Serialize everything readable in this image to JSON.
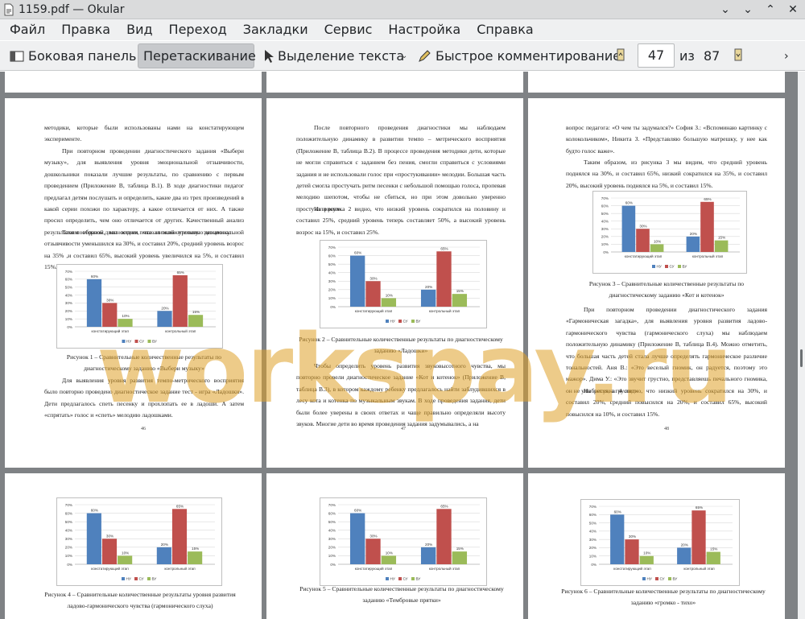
{
  "window": {
    "title": "1159.pdf — Okular"
  },
  "menu": [
    "Файл",
    "Правка",
    "Вид",
    "Переход",
    "Закладки",
    "Сервис",
    "Настройка",
    "Справка"
  ],
  "toolbar": {
    "sidebar_label": "Боковая панель",
    "drag_label": "Перетаскивание",
    "select_label": "Выделение текста",
    "comment_label": "Быстрое комментирование",
    "page_current": "47",
    "page_of": "из",
    "page_total": "87"
  },
  "pages": {
    "p46": {
      "paras": [
        {
          "text": "методики, которые были использованы нами на констатирующем эксперименте.",
          "indent": false
        },
        {
          "text": "При повторном проведении диагностического задания «Выбери музыку», для выявления уровня эмоциональной отзывчивости, дошкольники показали лучшие результаты, по сравнению с первым проведением (Приложение В, таблица В.1). В ходе диагностики педагог предлагал детям послушать и определить, какие два из трех произведений в какой серии похожи по характеру, а какое отличается от них. А также просил определить, чем оно отличается от других. Качественный анализ результатов повторной диагностики показал положительную динамику.",
          "indent": true
        },
        {
          "text": "Таким образом, мы видим, что низкий уровень эмоциональной отзывчивости уменьшился на 30%, и составил 20%, средний уровень возрос на 35% ,и составил 65%, высокий уровень увеличился на 5%, и составил 15%.",
          "indent": true
        }
      ],
      "caption": "Рисунок 1 – Сравнительные количественные результаты по диагностическому заданию «Выбери музыку»",
      "after": "Для выявления уровня развития темпо-метрического восприятия было повторно проведено диагностическое задание тест - игра «Ладошки». Дети предлагалось спеть песенку и прохлопать ее в ладоши. А затем «спрятать» голос и «спеть» мелодию ладошками.",
      "number": "46"
    },
    "p47": {
      "paras": [
        {
          "text": "После повторного проведения диагностики мы наблюдаем положительную динамику в развитии темпо – метрического восприятия (Приложение В, таблица В.2). В процессе проведения методики дети, которые не могли справиться с заданием без пения, смогли справиться с условиями задания и не использовали голос при «простукивании» мелодии. Большая часть детей смогла простучать ритм песенки с небольшой помощью голоса, пропевая мелодию шепотом, чтобы не сбиться, но при этом довольно уверенно простучали ритм.",
          "indent": true
        },
        {
          "text": "Из рисунка 2 видно, что низкий уровень сократился на половину и составил 25%, средний уровень теперь составляет 50%, а высокий уровень возрос на 15%, и составил 25%.",
          "indent": true
        }
      ],
      "caption": "Рисунок 2 – Сравнительные количественные результаты по диагностическому заданию «Ладошки»",
      "after": "Чтобы определить уровень развития звуковысотного чувства, мы повторно провели диагностическое задание «Кот и котенок» (Приложение В, таблица В.3), в котором каждому ребенку предлагалось найти заблудившихся в лесу кота и котенка по музыкальным звукам. В ходе проведения задания, дети были более уверены в своих ответах и чаще правильно определяли высоту звуков. Многие дети во время проведения задания задумывались, а на",
      "number": "47"
    },
    "p48": {
      "paras": [
        {
          "text": "вопрос педагога: «О чем ты задумался?» София З.: «Вспоминаю картинку с колокольчиком», Никита З. «Представляю большую матрешку, у нее как будто голос важе».",
          "indent": false
        },
        {
          "text": "Таким образом, из рисунка 3 мы видим, что средний уровень поднялся на 30%, и составил 65%, низкий сократился на 35%, и составил 20%, высокий уровень поднялся на 5%, и составил 15%.",
          "indent": true
        }
      ],
      "caption": "Рисунок 3 – Сравнительные количественные результаты по диагностическому заданию «Кот и котенок»",
      "after": "При повторном проведении диагностического задания «Гармоническая загадка», для выявления уровня развития ладово-гармонического чувства (гармонического слуха) мы наблюдаем положительную динамику (Приложение В, таблица В.4). Можно отметить, что большая часть детей стала лучше определять гармоническое различие тональностей. Аня В.: «Это веселый гномик, он радуется, поэтому это мажор». Дима У.: «Это звучит грустно, представляешь печального гномика, он не улыбается, а грустит»",
      "after2": "Из рисунка 4 видно, что низкий уровень сократился на 30%, и составил 20%, средний повысился на 20%, и составил 65%, высокий повысился на 10%, и составил 15%.",
      "number": "48"
    },
    "p49": {
      "caption": "Рисунок 4 – Сравнительные количественные результаты уровня развития ладово-гармонического чувства (гармонического слуха)"
    },
    "p50": {
      "caption": "Рисунок 5 – Сравнительные количественные результаты по диагностическому заданию «Тембровые прятки»"
    },
    "p51": {
      "caption": "Рисунок 6 – Сравнительные количественные результаты по диагностическому заданию «громко - тихо»"
    }
  },
  "watermark": "workspay.ru",
  "chart_data": [
    {
      "id": "fig1",
      "type": "bar",
      "categories": [
        "констатирующий этап",
        "контрольный этап"
      ],
      "series": [
        {
          "name": "НУ",
          "color": "#4f81bd",
          "values": [
            60,
            20
          ]
        },
        {
          "name": "СУ",
          "color": "#c0504d",
          "values": [
            30,
            65
          ]
        },
        {
          "name": "ВУ",
          "color": "#9bbb59",
          "values": [
            10,
            15
          ]
        }
      ],
      "labels": [
        [
          "60%",
          "20%"
        ],
        [
          "30%",
          "65%"
        ],
        [
          "10%",
          "15%"
        ]
      ],
      "yticks": [
        "0%",
        "10%",
        "20%",
        "30%",
        "40%",
        "50%",
        "60%",
        "70%"
      ],
      "ylim": [
        0,
        70
      ]
    },
    {
      "id": "fig2",
      "type": "bar",
      "categories": [
        "констатирующий этап",
        "контрольный этап"
      ],
      "series": [
        {
          "name": "НУ",
          "color": "#4f81bd",
          "values": [
            60,
            20
          ]
        },
        {
          "name": "СУ",
          "color": "#c0504d",
          "values": [
            30,
            65
          ]
        },
        {
          "name": "ВУ",
          "color": "#9bbb59",
          "values": [
            10,
            15
          ]
        }
      ],
      "labels": [
        [
          "60%",
          "20%"
        ],
        [
          "30%",
          "65%"
        ],
        [
          "10%",
          "15%"
        ]
      ],
      "yticks": [
        "0%",
        "10%",
        "20%",
        "30%",
        "40%",
        "50%",
        "60%",
        "70%"
      ],
      "ylim": [
        0,
        70
      ]
    },
    {
      "id": "fig3",
      "type": "bar",
      "categories": [
        "констатирующий этап",
        "контрольный этап"
      ],
      "series": [
        {
          "name": "НУ",
          "color": "#4f81bd",
          "values": [
            60,
            20
          ]
        },
        {
          "name": "СУ",
          "color": "#c0504d",
          "values": [
            30,
            65
          ]
        },
        {
          "name": "ВУ",
          "color": "#9bbb59",
          "values": [
            10,
            15
          ]
        }
      ],
      "labels": [
        [
          "60%",
          "20%"
        ],
        [
          "30%",
          "65%"
        ],
        [
          "10%",
          "15%"
        ]
      ],
      "yticks": [
        "0%",
        "10%",
        "20%",
        "30%",
        "40%",
        "50%",
        "60%",
        "70%"
      ],
      "ylim": [
        0,
        70
      ]
    },
    {
      "id": "fig4",
      "type": "bar",
      "categories": [
        "констатирующий этап",
        "контрольный этап"
      ],
      "series": [
        {
          "name": "НУ",
          "color": "#4f81bd",
          "values": [
            60,
            20
          ]
        },
        {
          "name": "СУ",
          "color": "#c0504d",
          "values": [
            30,
            65
          ]
        },
        {
          "name": "ВУ",
          "color": "#9bbb59",
          "values": [
            10,
            15
          ]
        }
      ],
      "labels": [
        [
          "60%",
          "20%"
        ],
        [
          "30%",
          "65%"
        ],
        [
          "10%",
          "15%"
        ]
      ],
      "yticks": [
        "0%",
        "10%",
        "20%",
        "30%",
        "40%",
        "50%",
        "60%",
        "70%"
      ],
      "ylim": [
        0,
        70
      ]
    },
    {
      "id": "fig5",
      "type": "bar",
      "categories": [
        "констатирующий этап",
        "контрольный этап"
      ],
      "series": [
        {
          "name": "НУ",
          "color": "#4f81bd",
          "values": [
            60,
            20
          ]
        },
        {
          "name": "СУ",
          "color": "#c0504d",
          "values": [
            30,
            65
          ]
        },
        {
          "name": "ВУ",
          "color": "#9bbb59",
          "values": [
            10,
            15
          ]
        }
      ],
      "labels": [
        [
          "60%",
          "20%"
        ],
        [
          "30%",
          "65%"
        ],
        [
          "10%",
          "15%"
        ]
      ],
      "yticks": [
        "0%",
        "10%",
        "20%",
        "30%",
        "40%",
        "50%",
        "60%",
        "70%"
      ],
      "ylim": [
        0,
        70
      ]
    },
    {
      "id": "fig6",
      "type": "bar",
      "categories": [
        "констатирующий этап",
        "контрольный этап"
      ],
      "series": [
        {
          "name": "НУ",
          "color": "#4f81bd",
          "values": [
            60,
            20
          ]
        },
        {
          "name": "СУ",
          "color": "#c0504d",
          "values": [
            30,
            65
          ]
        },
        {
          "name": "ВУ",
          "color": "#9bbb59",
          "values": [
            10,
            15
          ]
        }
      ],
      "labels": [
        [
          "60%",
          "20%"
        ],
        [
          "30%",
          "65%"
        ],
        [
          "10%",
          "15%"
        ]
      ],
      "yticks": [
        "0%",
        "10%",
        "20%",
        "30%",
        "40%",
        "50%",
        "60%",
        "70%"
      ],
      "ylim": [
        0,
        70
      ]
    }
  ]
}
